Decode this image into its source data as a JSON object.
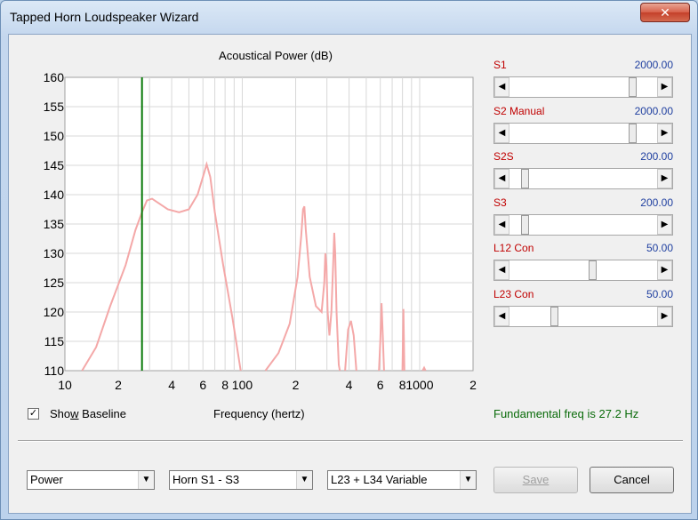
{
  "window": {
    "title": "Tapped Horn Loudspeaker Wizard",
    "close_glyph": "✕"
  },
  "chart_data": {
    "type": "line",
    "title": "Acoustical Power (dB)",
    "xlabel": "Frequency (hertz)",
    "ylabel": "",
    "xscale": "log",
    "xlim": [
      10,
      2000
    ],
    "ylim": [
      110,
      160
    ],
    "yticks": [
      "160",
      "155",
      "150",
      "145",
      "140",
      "135",
      "130",
      "125",
      "120",
      "115",
      "110"
    ],
    "xticks": [
      {
        "label": "10",
        "value": 10
      },
      {
        "label": "2",
        "value": 20
      },
      {
        "label": "4",
        "value": 40
      },
      {
        "label": "6",
        "value": 60
      },
      {
        "label": "8",
        "value": 80
      },
      {
        "label": "100",
        "value": 100
      },
      {
        "label": "2",
        "value": 200
      },
      {
        "label": "4",
        "value": 400
      },
      {
        "label": "6",
        "value": 600
      },
      {
        "label": "8",
        "value": 800
      },
      {
        "label": "1000",
        "value": 1000
      },
      {
        "label": "2",
        "value": 2000
      }
    ],
    "marker_freq": 27.2,
    "series": [
      {
        "color": "#f4a8a8",
        "points": [
          [
            12.5,
            110
          ],
          [
            15,
            114
          ],
          [
            18,
            121
          ],
          [
            22,
            128
          ],
          [
            25,
            134
          ],
          [
            27.2,
            137
          ],
          [
            29,
            139
          ],
          [
            31,
            139.3
          ],
          [
            34,
            138.5
          ],
          [
            38,
            137.5
          ],
          [
            44,
            137
          ],
          [
            50,
            137.5
          ],
          [
            56,
            140
          ],
          [
            60,
            143
          ],
          [
            63,
            145.2
          ],
          [
            66,
            143
          ],
          [
            70,
            137
          ],
          [
            78,
            128
          ],
          [
            88,
            119
          ],
          [
            98,
            110
          ]
        ],
        "segments": [
          [
            [
              135,
              110
            ],
            [
              160,
              113
            ],
            [
              185,
              118
            ],
            [
              205,
              126
            ],
            [
              215,
              133
            ],
            [
              220,
              137.5
            ],
            [
              224,
              138
            ],
            [
              228,
              134
            ],
            [
              240,
              126
            ],
            [
              260,
              121
            ],
            [
              280,
              120
            ],
            [
              290,
              125
            ],
            [
              294,
              130
            ],
            [
              298,
              128
            ],
            [
              303,
              120
            ],
            [
              310,
              116
            ],
            [
              318,
              120
            ],
            [
              326,
              129
            ],
            [
              330,
              133.5
            ],
            [
              334,
              130
            ],
            [
              340,
              120
            ],
            [
              350,
              111
            ],
            [
              355,
              110
            ]
          ],
          [
            [
              380,
              110
            ],
            [
              395,
              117
            ],
            [
              410,
              118.5
            ],
            [
              425,
              116
            ],
            [
              440,
              110
            ]
          ],
          [
            [
              590,
              110
            ],
            [
              600,
              115
            ],
            [
              610,
              121.5
            ],
            [
              620,
              116
            ],
            [
              630,
              110
            ]
          ],
          [
            [
              800,
              110
            ],
            [
              810,
              120.5
            ],
            [
              820,
              110
            ]
          ],
          [
            [
              1040,
              110
            ],
            [
              1060,
              110.5
            ],
            [
              1080,
              110
            ]
          ]
        ]
      }
    ],
    "colors": {
      "marker": "#0a7a0a",
      "grid": "#d8d8d8"
    }
  },
  "controls": {
    "show_baseline_pre": "Sho",
    "show_baseline_ul": "w",
    "show_baseline_post": " Baseline",
    "show_baseline_checked": "✓",
    "fundamental": "Fundamental freq is 27.2 Hz"
  },
  "sliders": [
    {
      "label": "S1",
      "value": "2000.00",
      "position": 0.86
    },
    {
      "label": "S2  Manual",
      "value": "2000.00",
      "position": 0.86
    },
    {
      "label": "S2S",
      "value": "200.00",
      "position": 0.08
    },
    {
      "label": "S3",
      "value": "200.00",
      "position": 0.08
    },
    {
      "label": "L12  Con",
      "value": "50.00",
      "position": 0.57
    },
    {
      "label": "L23  Con",
      "value": "50.00",
      "position": 0.29
    }
  ],
  "bottom": {
    "combo1": "Power",
    "combo2": "Horn S1 - S3",
    "combo3": "L23 + L34 Variable",
    "save": "Save",
    "cancel": "Cancel",
    "arrow_left": "◀",
    "arrow_right": "▶",
    "dropdown": "▼"
  }
}
